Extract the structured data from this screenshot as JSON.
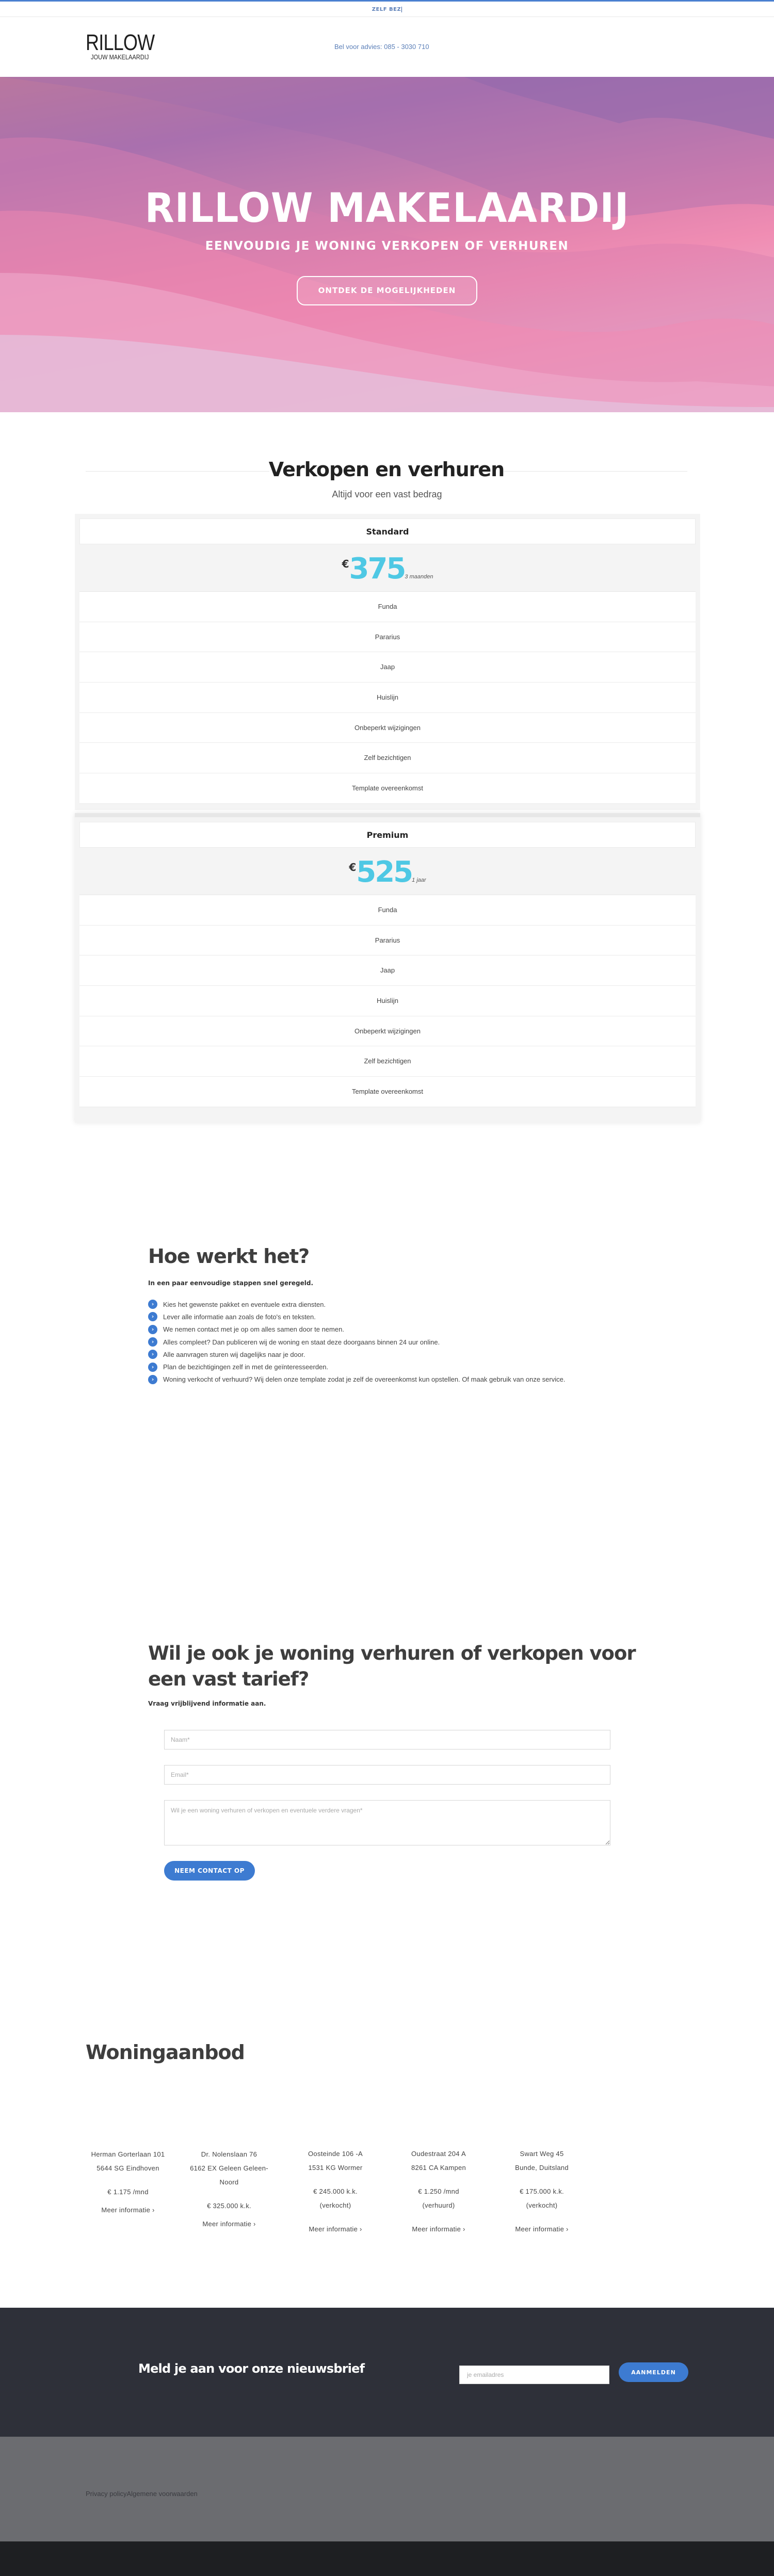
{
  "topbar": {
    "text": "ZELF BEZ"
  },
  "header": {
    "logo_main": "RILLOW",
    "logo_sub": "JOUW MAKELAARDIJ",
    "phone": "Bel voor advies: 085 - 3030 710"
  },
  "hero": {
    "title": "RILLOW MAKELAARDIJ",
    "subtitle": "EENVOUDIG JE WONING VERKOPEN OF VERHUREN",
    "button": "ONTDEK DE MOGELIJKHEDEN"
  },
  "pricing": {
    "title": "Verkopen en verhuren",
    "subtitle": "Altijd voor een vast bedrag",
    "accent_color": "#4ec8e4",
    "plans": [
      {
        "name": "Standard",
        "currency": "€",
        "amount": "375",
        "period": "3 maanden",
        "features": [
          "Funda",
          "Pararius",
          "Jaap",
          "Huislijn",
          "Onbeperkt wijzigingen",
          "Zelf bezichtigen",
          "Template overeenkomst"
        ]
      },
      {
        "name": "Premium",
        "currency": "€",
        "amount": "525",
        "period": "1 jaar",
        "features": [
          "Funda",
          "Pararius",
          "Jaap",
          "Huislijn",
          "Onbeperkt wijzigingen",
          "Zelf bezichtigen",
          "Template overeenkomst"
        ]
      }
    ]
  },
  "how": {
    "title": "Hoe werkt het?",
    "subtitle": "In een paar eenvoudige stappen snel geregeld.",
    "icon": "chevron-right-circle-icon",
    "steps": [
      "Kies het gewenste pakket en eventuele extra diensten.",
      "Lever alle informatie aan zoals de foto's en teksten.",
      "We nemen contact met je op om alles samen door te nemen.",
      "Alles compleet? Dan publiceren wij de woning en staat deze doorgaans binnen 24 uur online.",
      "Alle aanvragen sturen wij dagelijks naar je door.",
      "Plan de bezichtigingen zelf in met de geïnteresseerden.",
      "Woning verkocht of verhuurd? Wij delen onze template zodat je zelf de overeenkomst kun opstellen. Of maak gebruik van onze service."
    ]
  },
  "contact": {
    "title": "Wil je ook je woning verhuren of verkopen voor een vast tarief?",
    "subtitle": "Vraag vrijblijvend informatie aan.",
    "name_placeholder": "Naam*",
    "email_placeholder": "Email*",
    "message_placeholder": "Wil je een woning verhuren of verkopen en eventuele verdere vragen*",
    "button": "NEEM CONTACT OP"
  },
  "listings": {
    "title": "Woningaanbod",
    "items": [
      {
        "street": "Herman Gorterlaan 101",
        "city": "5644 SG Eindhoven",
        "price": "€ 1.175 /mnd",
        "status": "",
        "link": "Meer informatie ›"
      },
      {
        "street": "Dr. Nolenslaan 76",
        "city": "6162 EX Geleen Geleen-Noord",
        "price": "€ 325.000 k.k.",
        "status": "",
        "link": "Meer informatie ›"
      },
      {
        "street": "Oosteinde 106 -A",
        "city": "1531 KG Wormer",
        "price": "€ 245.000 k.k.",
        "status": "(verkocht)",
        "link": "Meer informatie ›"
      },
      {
        "street": "Oudestraat 204 A",
        "city": "8261 CA Kampen",
        "price": "€ 1.250 /mnd",
        "status": "(verhuurd)",
        "link": "Meer informatie ›"
      },
      {
        "street": "Swart Weg 45",
        "city": "Bunde, Duitsland",
        "price": "€ 175.000 k.k.",
        "status": "(verkocht)",
        "link": "Meer informatie ›"
      }
    ]
  },
  "newsletter": {
    "title": "Meld je aan voor onze nieuwsbrief",
    "email_placeholder": "je emailadres",
    "button": "AANMELDEN"
  },
  "footer": {
    "links": [
      "Privacy policy",
      "Algemene voorwaarden"
    ]
  },
  "colors": {
    "brand_blue": "#3d7bd1",
    "dark_section": "#2e3039",
    "footer_gray": "#6b6c70"
  }
}
